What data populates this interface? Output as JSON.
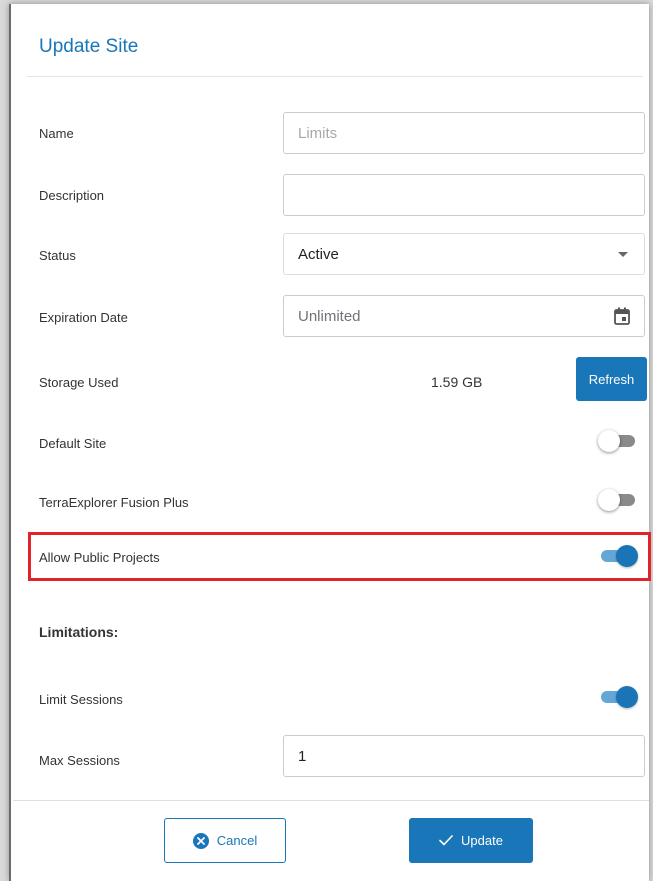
{
  "dialog": {
    "title": "Update Site"
  },
  "fields": {
    "name": {
      "label": "Name",
      "value": "",
      "placeholder": "Limits"
    },
    "description": {
      "label": "Description",
      "value": ""
    },
    "status": {
      "label": "Status",
      "selected": "Active"
    },
    "expiration": {
      "label": "Expiration Date",
      "value": "Unlimited"
    },
    "storage": {
      "label": "Storage Used",
      "value": "1.59 GB",
      "refresh_label": "Refresh"
    },
    "default_site": {
      "label": "Default Site",
      "on": false
    },
    "fusion_plus": {
      "label": "TerraExplorer Fusion Plus",
      "on": false
    },
    "public_projects": {
      "label": "Allow Public Projects",
      "on": true
    },
    "limitations_header": "Limitations:",
    "limit_sessions": {
      "label": "Limit Sessions",
      "on": true
    },
    "max_sessions": {
      "label": "Max Sessions",
      "value": "1"
    }
  },
  "footer": {
    "cancel_label": "Cancel",
    "update_label": "Update"
  },
  "colors": {
    "accent": "#1976b8",
    "highlight": "#e0242a"
  }
}
